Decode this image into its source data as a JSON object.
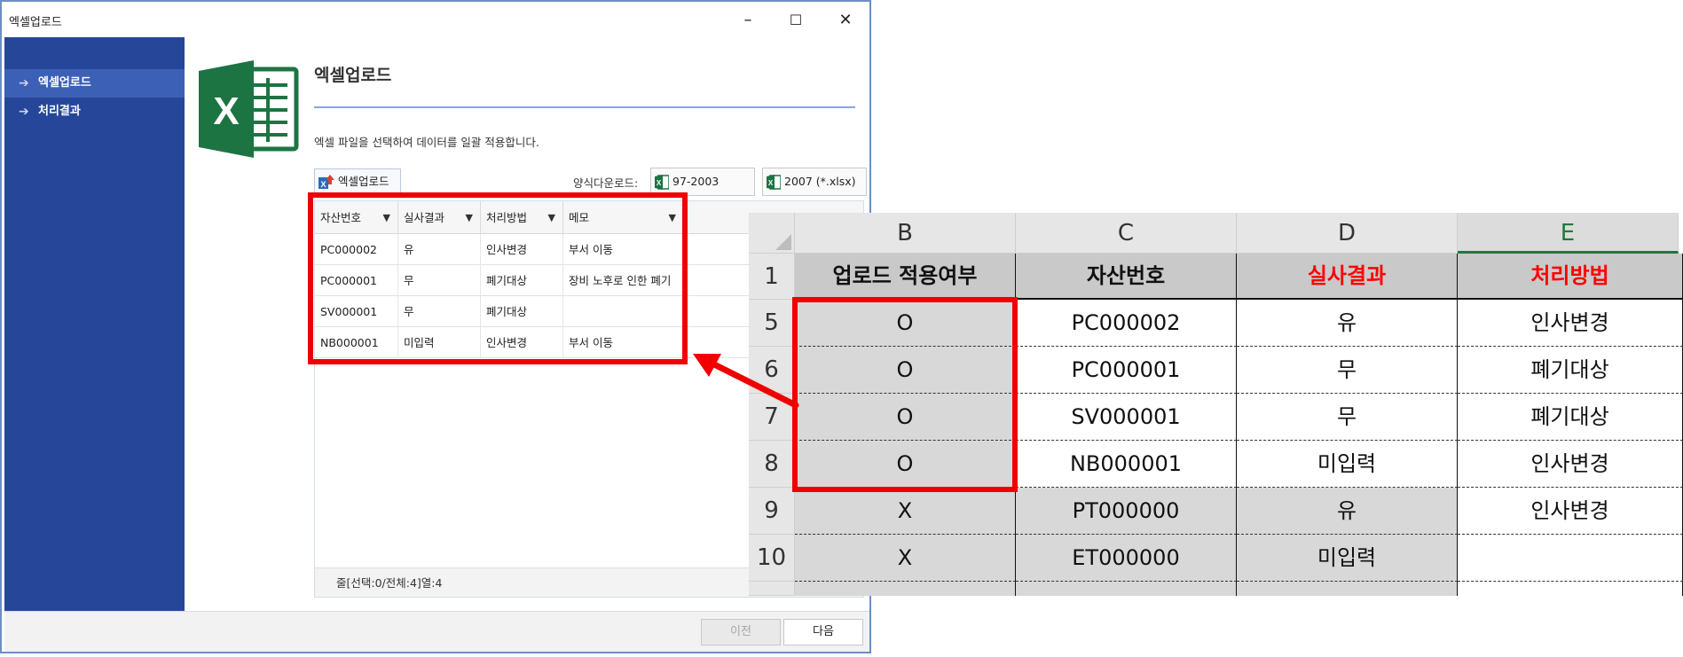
{
  "window": {
    "title": "엑셀업로드",
    "minimize": "–",
    "maximize": "☐",
    "close": "✕"
  },
  "sidebar": {
    "items": [
      {
        "label": "엑셀업로드",
        "active": true
      },
      {
        "label": "처리결과",
        "active": false
      }
    ]
  },
  "page": {
    "heading": "엑셀업로드",
    "description": "엑셀 파일을 선택하여 데이터를 일괄 적용합니다.",
    "upload_button": "엑셀업로드",
    "download_label": "양식다운로드:",
    "download_xls": "97-2003 (*.xls)",
    "download_xlsx": "2007 (*.xlsx)",
    "accent_color": "#26469a"
  },
  "grid": {
    "columns": [
      "자산번호",
      "실사결과",
      "처리방법",
      "메모"
    ],
    "rows": [
      [
        "PC000002",
        "유",
        "인사변경",
        "부서 이동"
      ],
      [
        "PC000001",
        "무",
        "폐기대상",
        "장비 노후로 인한 폐기"
      ],
      [
        "SV000001",
        "무",
        "폐기대상",
        ""
      ],
      [
        "NB000001",
        "미입력",
        "인사변경",
        "부서 이동"
      ]
    ],
    "status": "줄[선택:0/전체:4]열:4"
  },
  "footer": {
    "prev": "이전",
    "next": "다음"
  },
  "sheet": {
    "col_headers": [
      "B",
      "C",
      "D",
      "E"
    ],
    "header_row": {
      "row_num": "1",
      "cells": [
        "업로드 적용여부",
        "자산번호",
        "실사결과",
        "처리방법"
      ]
    },
    "rows": [
      {
        "row_num": "5",
        "cells": [
          "O",
          "PC000002",
          "유",
          "인사변경"
        ]
      },
      {
        "row_num": "6",
        "cells": [
          "O",
          "PC000001",
          "무",
          "폐기대상"
        ]
      },
      {
        "row_num": "7",
        "cells": [
          "O",
          "SV000001",
          "무",
          "폐기대상"
        ]
      },
      {
        "row_num": "8",
        "cells": [
          "O",
          "NB000001",
          "미입력",
          "인사변경"
        ]
      },
      {
        "row_num": "9",
        "cells": [
          "X",
          "PT000000",
          "유",
          "인사변경"
        ]
      },
      {
        "row_num": "10",
        "cells": [
          "X",
          "ET000000",
          "미입력",
          ""
        ]
      }
    ],
    "highlight_color": "#f00000",
    "header_red_color": "#ff0000"
  }
}
